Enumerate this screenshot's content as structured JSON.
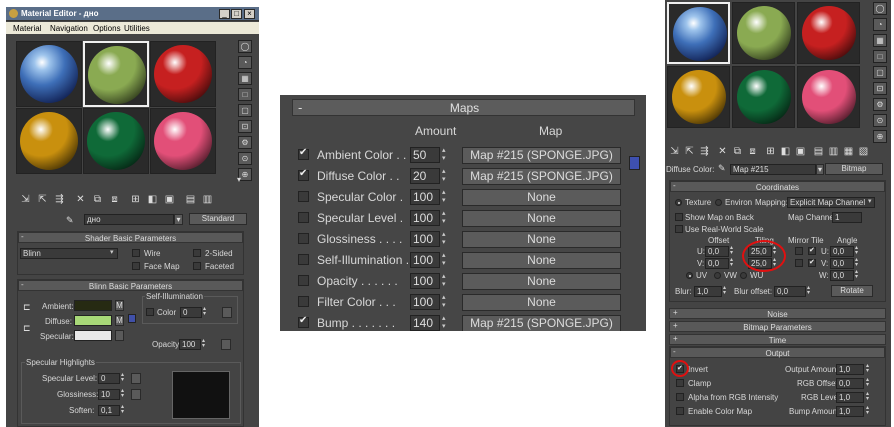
{
  "left": {
    "title": "Material Editor - дно",
    "window_buttons": [
      "_",
      "□",
      "×"
    ],
    "menu": [
      "Material",
      "Navigation",
      "Options",
      "Utilities"
    ],
    "spheres": [
      {
        "name": "sky",
        "color": "#3a5da8"
      },
      {
        "name": "green",
        "color": "#8aaa52"
      },
      {
        "name": "red",
        "color": "#c62020"
      },
      {
        "name": "ochre",
        "color": "#c9900e"
      },
      {
        "name": "dark-green",
        "color": "#0f6a38"
      },
      {
        "name": "pink",
        "color": "#e24f78"
      }
    ],
    "material_name": "дно",
    "material_type": "Standard",
    "shader_rollout": "Shader Basic Parameters",
    "shader_value": "Blinn",
    "shader_options": [
      "Wire",
      "2-Sided",
      "Face Map",
      "Faceted"
    ],
    "blinn_rollout": "Blinn Basic Parameters",
    "self_illum_group": "Self-Illumination",
    "ambient_label": "Ambient:",
    "diffuse_label": "Diffuse:",
    "specular_label": "Specular:",
    "map_btn": "M",
    "color_label": "Color",
    "color_value": "0",
    "opacity_label": "Opacity:",
    "opacity_value": "100",
    "ambient_color": "#262a12",
    "diffuse_color": "#a8d878",
    "specular_color": "#e8e8e8",
    "spec_group": "Specular Highlights",
    "spec_level_label": "Specular Level:",
    "spec_level_value": "0",
    "gloss_label": "Glossiness:",
    "gloss_value": "10",
    "soften_label": "Soften:",
    "soften_value": "0,1"
  },
  "middle": {
    "title": "Maps",
    "amount_header": "Amount",
    "map_header": "Map",
    "rows": [
      {
        "label": "Ambient Color . .",
        "checked": true,
        "amount": "50",
        "map": "Map #215 (SPONGE.JPG)"
      },
      {
        "label": "Diffuse Color . .",
        "checked": true,
        "amount": "20",
        "map": "Map #215 (SPONGE.JPG)"
      },
      {
        "label": "Specular Color .",
        "checked": false,
        "amount": "100",
        "map": "None"
      },
      {
        "label": "Specular Level .",
        "checked": false,
        "amount": "100",
        "map": "None"
      },
      {
        "label": "Glossiness . . . .",
        "checked": false,
        "amount": "100",
        "map": "None"
      },
      {
        "label": "Self-Illumination .",
        "checked": false,
        "amount": "100",
        "map": "None"
      },
      {
        "label": "Opacity . . . . . .",
        "checked": false,
        "amount": "100",
        "map": "None"
      },
      {
        "label": "Filter Color . . .",
        "checked": false,
        "amount": "100",
        "map": "None"
      },
      {
        "label": "Bump . . . . . . .",
        "checked": true,
        "amount": "140",
        "map": "Map #215 (SPONGE.JPG)"
      }
    ]
  },
  "right": {
    "spheres": [
      {
        "name": "sky",
        "color": "#3a5da8"
      },
      {
        "name": "green",
        "color": "#8aaa52"
      },
      {
        "name": "red",
        "color": "#c62020"
      },
      {
        "name": "ochre",
        "color": "#c9900e"
      },
      {
        "name": "dark-green",
        "color": "#0f6a38"
      },
      {
        "name": "pink",
        "color": "#e24f78"
      }
    ],
    "label_diffuse": "Diffuse Color:",
    "map_name": "Map #215",
    "map_type": "Bitmap",
    "coords_rollout": "Coordinates",
    "texture_label": "Texture",
    "environ_label": "Environ",
    "mapping_label": "Mapping:",
    "mapping_value": "Explicit Map Channel",
    "show_map_label": "Show Map on Back",
    "map_channel_label": "Map Channel:",
    "map_channel_value": "1",
    "real_world_label": "Use Real-World Scale",
    "offset_header": "Offset",
    "tiling_header": "Tiling",
    "mirror_tile_header": "Mirror Tile",
    "angle_header": "Angle",
    "u_label": "U:",
    "v_label": "V:",
    "w_label": "W:",
    "u_offset": "0,0",
    "v_offset": "0,0",
    "u_tiling": "25,0",
    "v_tiling": "25,0",
    "u_angle": "0,0",
    "v_angle": "0,0",
    "w_angle": "0,0",
    "uv_label": "UV",
    "vw_label": "VW",
    "wu_label": "WU",
    "blur_label": "Blur:",
    "blur_value": "1,0",
    "blur_offset_label": "Blur offset:",
    "blur_offset_value": "0,0",
    "rotate_btn": "Rotate",
    "noise_rollout": "Noise",
    "bitmap_rollout": "Bitmap Parameters",
    "time_rollout": "Time",
    "output_rollout": "Output",
    "invert_label": "Invert",
    "clamp_label": "Clamp",
    "alpha_label": "Alpha from RGB Intensity",
    "enable_color_map_label": "Enable Color Map",
    "output_amount_label": "Output Amount:",
    "output_amount_value": "1,0",
    "rgb_offset_label": "RGB Offset:",
    "rgb_offset_value": "0,0",
    "rgb_level_label": "RGB Level:",
    "rgb_level_value": "1,0",
    "bump_amount_label": "Bump Amount:",
    "bump_amount_value": "1,0",
    "plus": "+",
    "minus": "-",
    "dots": "..."
  }
}
